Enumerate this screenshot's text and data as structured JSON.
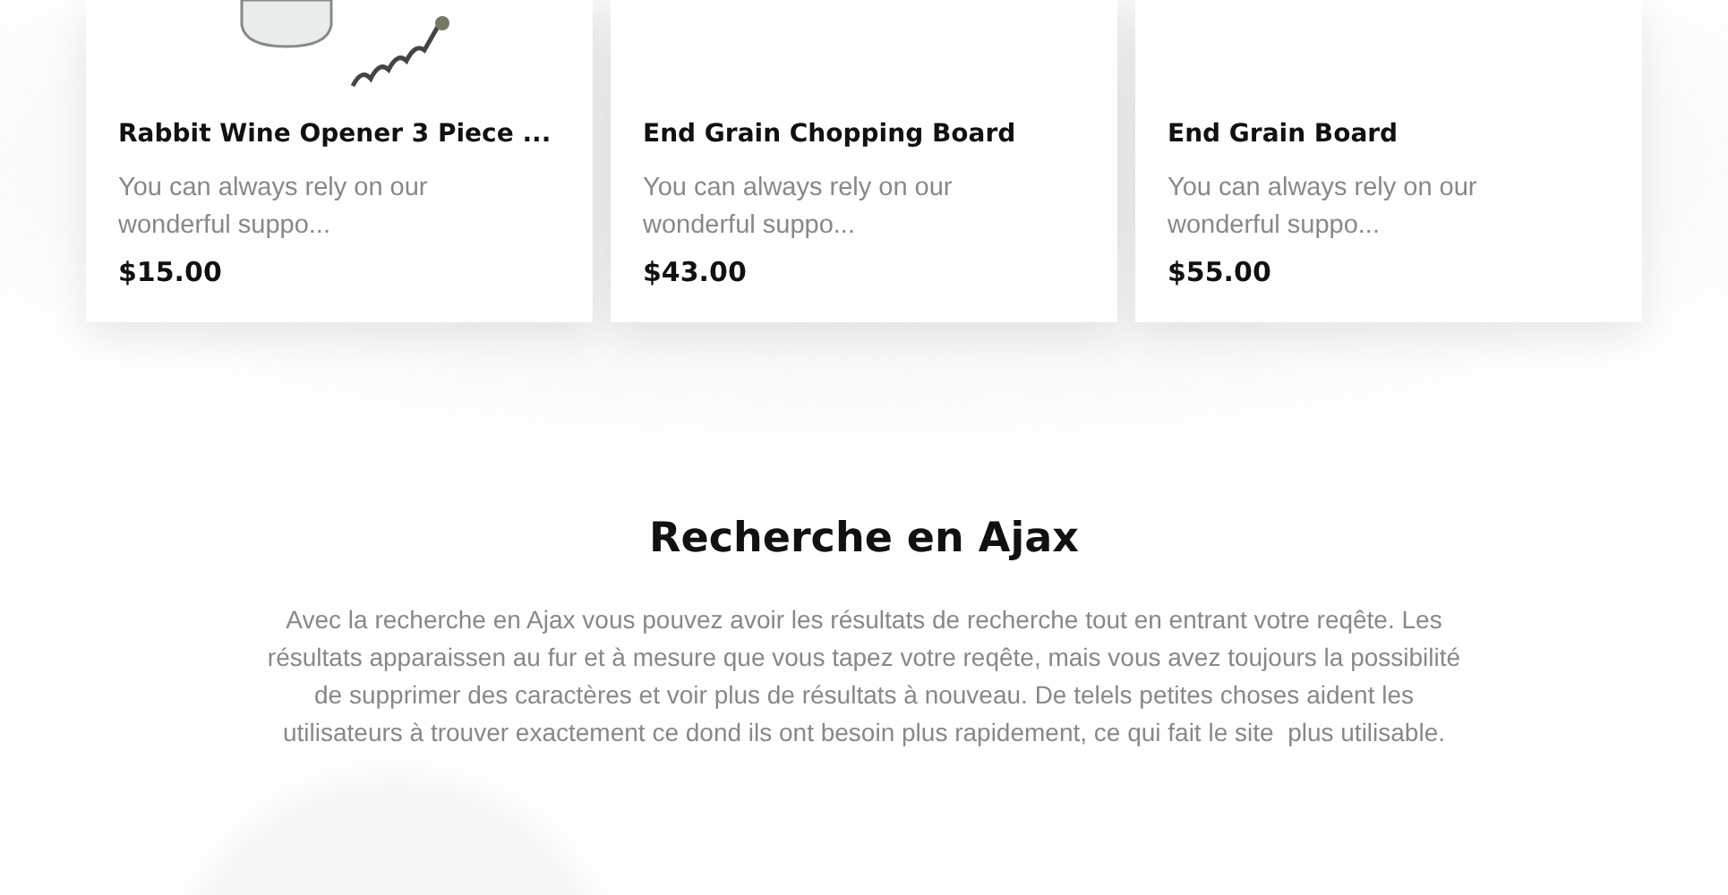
{
  "products": [
    {
      "name": "Rabbit Wine Opener 3 Piece ...",
      "description": "You can always rely on our wonderful suppo...",
      "price": "$15.00",
      "kind": "corkscrew"
    },
    {
      "name": "End Grain Chopping Board",
      "description": "You can always rely on our wonderful suppo...",
      "price": "$43.00",
      "kind": "blank"
    },
    {
      "name": "End Grain Board",
      "description": "You can always rely on our wonderful suppo...",
      "price": "$55.00",
      "kind": "blank"
    }
  ],
  "section": {
    "title": "Recherche en Ajax",
    "text": "Avec la recherche en Ajax vous pouvez avoir les résultats de recherche tout en entrant votre reqête. Les résultats apparaissen au fur et à mesure que vous tapez votre reqête, mais vous avez toujours la possibilité de supprimer des caractères et voir plus de résultats à nouveau. De telels petites choses aident les utilisateurs à trouver exactement ce dond ils ont besoin plus rapidement, ce qui fait le site  plus utilisable."
  }
}
